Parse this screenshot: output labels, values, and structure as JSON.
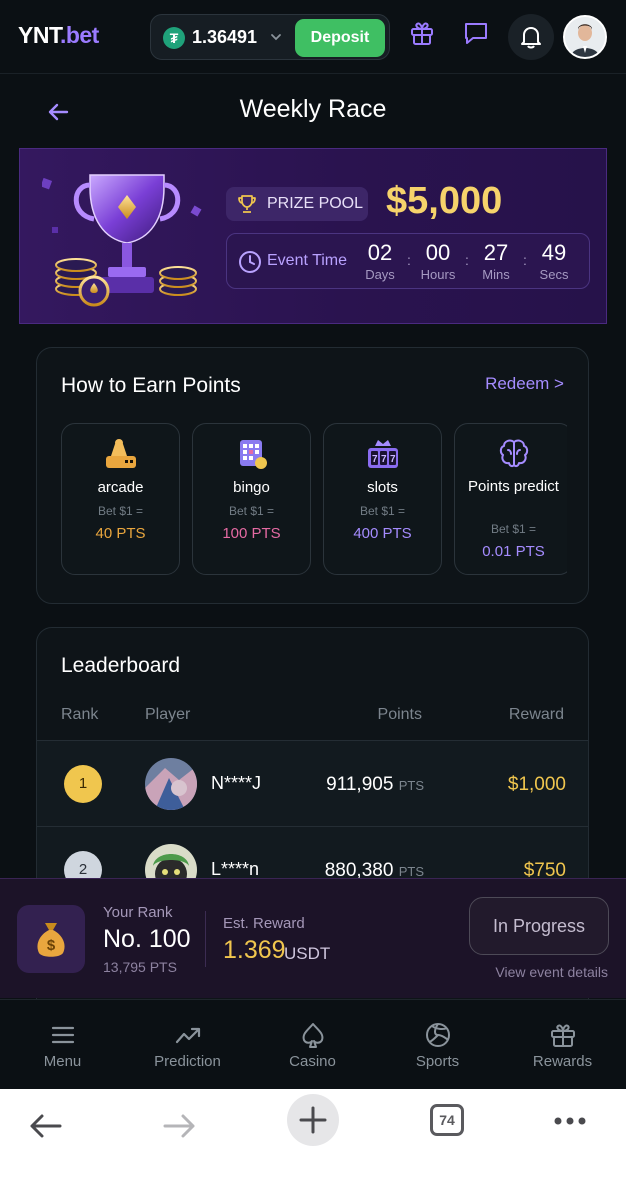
{
  "header": {
    "logo_main": "YNT",
    "logo_dot": ".bet",
    "balance": "1.36491",
    "deposit_label": "Deposit"
  },
  "page": {
    "title": "Weekly Race"
  },
  "banner": {
    "prize_pool_label": "PRIZE POOL",
    "prize_amount": "$5,000",
    "event_time_label": "Event Time",
    "countdown": [
      {
        "value": "02",
        "unit": "Days"
      },
      {
        "value": "00",
        "unit": "Hours"
      },
      {
        "value": "27",
        "unit": "Mins"
      },
      {
        "value": "49",
        "unit": "Secs"
      }
    ]
  },
  "earn": {
    "title": "How to Earn Points",
    "redeem_label": "Redeem >",
    "tiles": [
      {
        "name": "arcade",
        "bet": "Bet $1 =",
        "pts": "40 PTS",
        "color": "#e9a63e"
      },
      {
        "name": "bingo",
        "bet": "Bet $1 =",
        "pts": "100 PTS",
        "color": "#e56aa3"
      },
      {
        "name": "slots",
        "bet": "Bet $1 =",
        "pts": "400 PTS",
        "color": "#a58cff"
      },
      {
        "name": "Points predict",
        "bet": "Bet $1 =",
        "pts": "0.01 PTS",
        "color": "#a58cff"
      }
    ]
  },
  "leaderboard": {
    "title": "Leaderboard",
    "headers": {
      "rank": "Rank",
      "player": "Player",
      "points": "Points",
      "reward": "Reward"
    },
    "rows": [
      {
        "rank": "1",
        "player": "N****J",
        "points": "911,905",
        "unit": "PTS",
        "reward": "$1,000"
      },
      {
        "rank": "2",
        "player": "L****n",
        "points": "880,380",
        "unit": "PTS",
        "reward": "$750"
      }
    ]
  },
  "my_rank": {
    "rank_label": "Your Rank",
    "rank_value": "No. 100",
    "points": "13,795 PTS",
    "reward_label": "Est. Reward",
    "reward_value": "1.369",
    "reward_currency": "USDT",
    "status_button": "In Progress",
    "details_link": "View event details"
  },
  "bottom_nav": [
    {
      "label": "Menu",
      "icon": "menu-icon"
    },
    {
      "label": "Prediction",
      "icon": "trend-icon"
    },
    {
      "label": "Casino",
      "icon": "spade-icon"
    },
    {
      "label": "Sports",
      "icon": "volleyball-icon"
    },
    {
      "label": "Rewards",
      "icon": "gift-icon"
    }
  ],
  "browser": {
    "tab_count": "74"
  }
}
